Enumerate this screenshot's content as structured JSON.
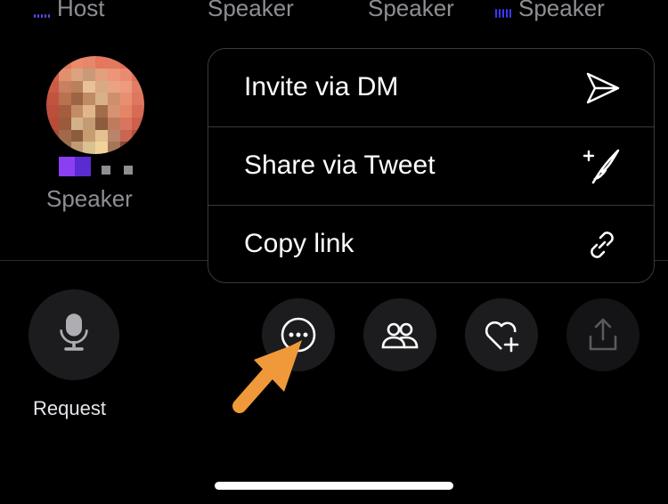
{
  "roles": {
    "host": "Host",
    "speaker_2": "Speaker",
    "speaker_3": "Speaker",
    "speaker_4": "Speaker"
  },
  "speaker_tile": {
    "role_label": "Speaker"
  },
  "menu": {
    "items": [
      {
        "label": "Invite via DM",
        "icon": "send-icon"
      },
      {
        "label": "Share via Tweet",
        "icon": "compose-tweet-icon"
      },
      {
        "label": "Copy link",
        "icon": "link-icon"
      }
    ]
  },
  "actions": {
    "request_label": "Request",
    "buttons": [
      "microphone-icon",
      "more-icon",
      "people-icon",
      "heart-add-icon",
      "share-icon"
    ]
  },
  "colors": {
    "background": "#000000",
    "menu_border": "#3a3a3c",
    "button_bg": "#1c1c1e",
    "text_secondary": "#8e8e93",
    "speaking_indicator": "#5b4bff",
    "annotation_arrow": "#f0993a"
  }
}
